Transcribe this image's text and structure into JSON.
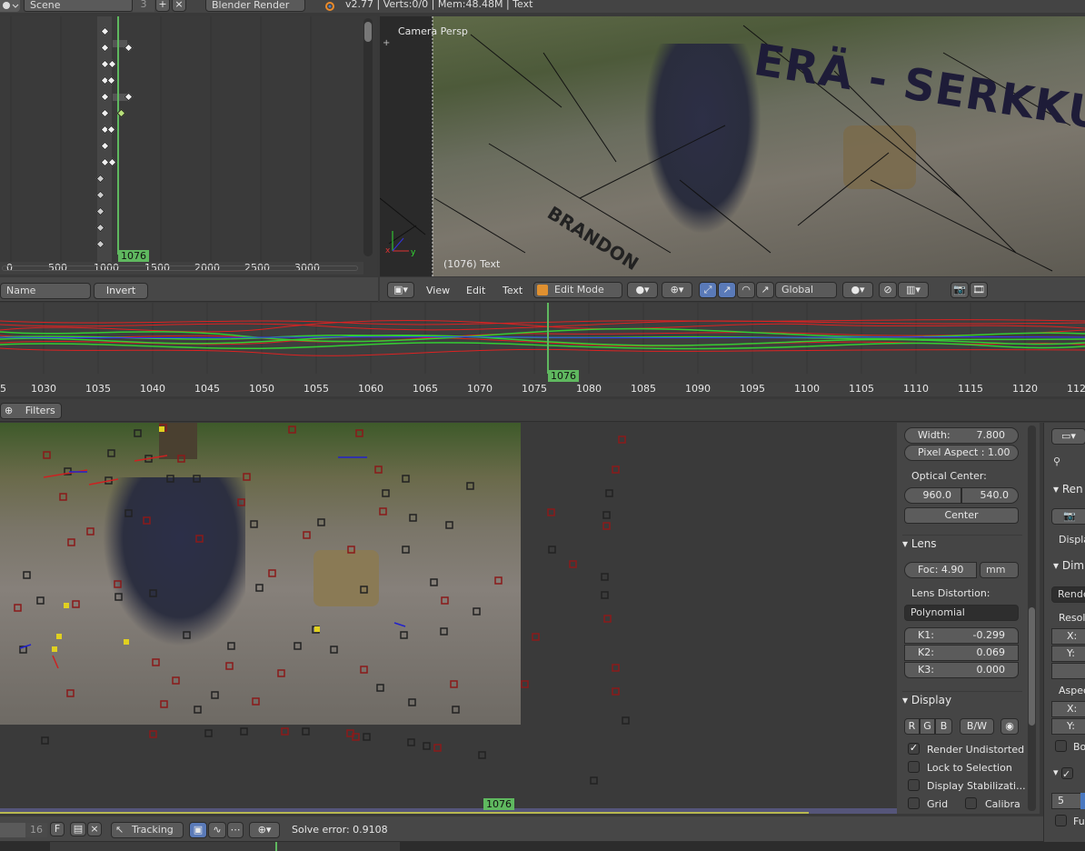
{
  "info": {
    "scene": "Scene",
    "scene_users": "3",
    "engine": "Blender Render",
    "stats": "v2.77 | Verts:0/0 | Mem:48.48M | Text"
  },
  "dopesheet": {
    "current_frame": "1076",
    "ticks": [
      "0",
      "500",
      "1000",
      "1500",
      "2000",
      "2500",
      "3000"
    ],
    "name_filter": "Name",
    "invert_label": "Invert"
  },
  "viewport": {
    "view_name": "Camera Persp",
    "object_label": "(1076) Text",
    "menu": [
      "View",
      "Edit",
      "Text"
    ],
    "mode": "Edit Mode",
    "orientation": "Global",
    "overlay_text_1": "ERÄ - SERKKU",
    "overlay_text_2": "BRANDON"
  },
  "graph": {
    "current_frame": "1076",
    "ticks": [
      "5",
      "1030",
      "1035",
      "1040",
      "1045",
      "1050",
      "1055",
      "1060",
      "1065",
      "1070",
      "1075",
      "1080",
      "1085",
      "1090",
      "1095",
      "1100",
      "1105",
      "1110",
      "1115",
      "1120",
      "112"
    ]
  },
  "filters": {
    "label": "Filters"
  },
  "clip": {
    "current_frame": "1076",
    "frame_field": "16",
    "f_label": "F",
    "mode": "Tracking",
    "status": "Solve error: 0.9108"
  },
  "props": {
    "width_label": "Width:",
    "width_value": "7.800",
    "pixel_aspect": "Pixel Aspect : 1.00",
    "optical_center_label": "Optical Center:",
    "oc_x": "960.0",
    "oc_y": "540.0",
    "center_btn": "Center",
    "lens_header": "Lens",
    "focal": "Foc: 4.90",
    "focal_unit": "mm",
    "distortion_label": "Lens Distortion:",
    "distortion_model": "Polynomial",
    "k1_label": "K1:",
    "k1": "-0.299",
    "k2_label": "K2:",
    "k2": "0.069",
    "k3_label": "K3:",
    "k3": "0.000",
    "display_header": "Display",
    "rgb": [
      "R",
      "G",
      "B"
    ],
    "bw": "B/W",
    "checks": [
      "Render Undistorted",
      "Lock to Selection",
      "Display Stabilizati...",
      "Grid"
    ],
    "calibra": "Calibra"
  },
  "render_props": {
    "ren": "Ren",
    "displa": "Displa",
    "dim": "Dim",
    "rende": "Rende",
    "resolu": "Resolu",
    "x": "X:",
    "y": "Y:",
    "aspec": "Aspec",
    "bo": "Bo",
    "five": "5",
    "fu": "Fu"
  },
  "colors": {
    "green": "#5fb85f",
    "bg": "#393939",
    "header": "#474747"
  }
}
